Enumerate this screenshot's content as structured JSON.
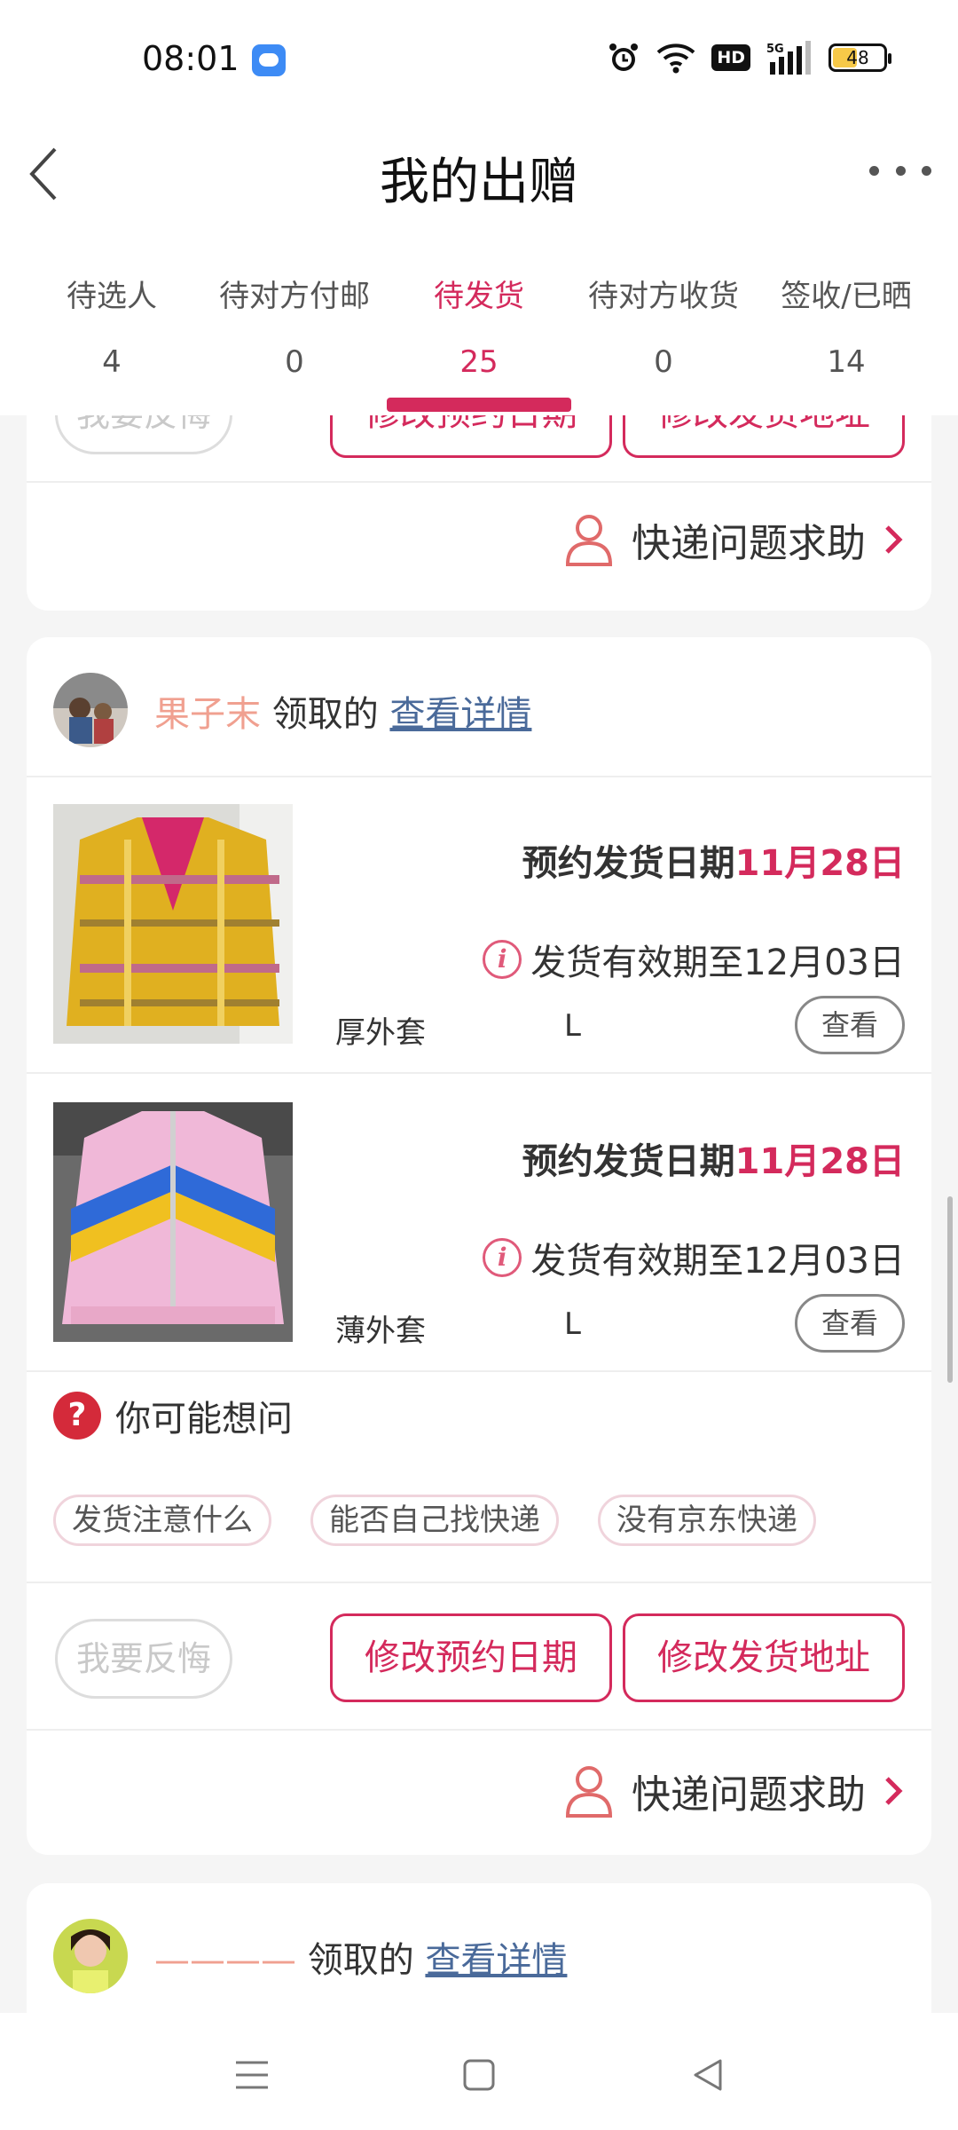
{
  "status_bar": {
    "time": "08:01",
    "network": "5G",
    "hd": "HD",
    "battery_level": "48"
  },
  "header": {
    "title": "我的出赠"
  },
  "tabs": [
    {
      "label": "待选人",
      "count": "4"
    },
    {
      "label": "待对方付邮",
      "count": "0"
    },
    {
      "label": "待发货",
      "count": "25",
      "active": true
    },
    {
      "label": "待对方收货",
      "count": "0"
    },
    {
      "label": "签收/已晒",
      "count": "14"
    }
  ],
  "top_card": {
    "regret_button": "我要反悔",
    "modify_date_button": "修改预约日期",
    "modify_address_button": "修改发货地址",
    "help_text": "快递问题求助"
  },
  "order_card": {
    "claimer": "果子末",
    "claimed_text": "领取的",
    "detail_link": "查看详情",
    "items": [
      {
        "date_label": "预约发货日期",
        "date_value": "11月28日",
        "valid_text": "发货有效期至12月03日",
        "name": "厚外套",
        "size": "L",
        "view_button": "查看"
      },
      {
        "date_label": "预约发货日期",
        "date_value": "11月28日",
        "valid_text": "发货有效期至12月03日",
        "name": "薄外套",
        "size": "L",
        "view_button": "查看"
      }
    ],
    "faq": {
      "title": "你可能想问",
      "chips": [
        "发货注意什么",
        "能否自己找快递",
        "没有京东快递"
      ]
    },
    "regret_button": "我要反悔",
    "modify_date_button": "修改预约日期",
    "modify_address_button": "修改发货地址",
    "help_text": "快递问题求助"
  },
  "next_card": {
    "claimer": "————",
    "claimed_text": "领取的",
    "detail_link": "查看详情"
  },
  "colors": {
    "accent": "#d42a5c",
    "link": "#4a6a9a",
    "claimer": "#f0a090"
  }
}
